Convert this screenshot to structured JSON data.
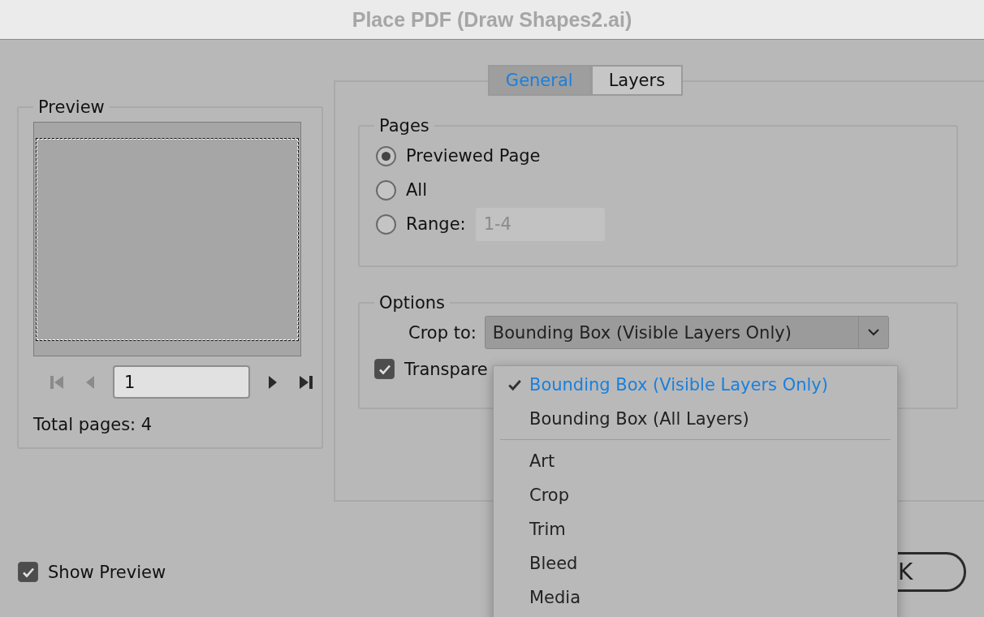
{
  "window": {
    "title": "Place PDF (Draw Shapes2.ai)"
  },
  "preview": {
    "legend": "Preview",
    "page_field": {
      "value": "1"
    },
    "total_pages": "Total pages: 4",
    "nav": [
      {
        "kind": "first",
        "disabled": true
      },
      {
        "kind": "prev",
        "disabled": true
      },
      {
        "kind": "next",
        "disabled": false
      },
      {
        "kind": "last",
        "disabled": false
      }
    ]
  },
  "tabs": [
    {
      "label": "General",
      "selected": true
    },
    {
      "label": "Layers",
      "selected": false
    }
  ],
  "pages": {
    "legend": "Pages",
    "options": [
      {
        "label": "Previewed Page",
        "selected": true
      },
      {
        "label": "All",
        "selected": false
      },
      {
        "label": "Range:",
        "selected": false
      }
    ],
    "range_field": {
      "value": "1-4",
      "disabled": true
    }
  },
  "options": {
    "legend": "Options",
    "crop_label": "Crop to:",
    "crop_value": "Bounding Box (Visible Layers Only)",
    "transparent": {
      "label": "Transpare",
      "checked": true
    }
  },
  "crop_menu": {
    "groups": [
      [
        {
          "label": "Bounding Box (Visible Layers Only)",
          "selected": true
        },
        {
          "label": "Bounding Box (All Layers)",
          "selected": false
        }
      ],
      [
        {
          "label": "Art",
          "selected": false
        },
        {
          "label": "Crop",
          "selected": false
        },
        {
          "label": "Trim",
          "selected": false
        },
        {
          "label": "Bleed",
          "selected": false
        },
        {
          "label": "Media",
          "selected": false
        }
      ]
    ]
  },
  "show_preview": {
    "label": "Show Preview",
    "checked": true
  },
  "ok_button": {
    "label": "K"
  }
}
